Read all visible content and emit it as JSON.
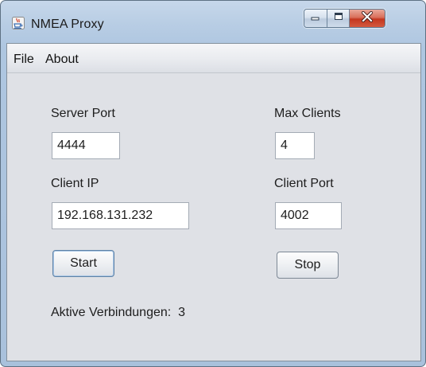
{
  "window": {
    "title": "NMEA Proxy",
    "icon": "java-cup-icon",
    "controls": [
      "minimize-icon",
      "maximize-icon",
      "close-icon"
    ]
  },
  "menu": {
    "items": [
      {
        "label": "File"
      },
      {
        "label": "About"
      }
    ]
  },
  "form": {
    "server_port": {
      "label": "Server Port",
      "value": "4444"
    },
    "max_clients": {
      "label": "Max Clients",
      "value": "4"
    },
    "client_ip": {
      "label": "Client IP",
      "value": "192.168.131.232"
    },
    "client_port": {
      "label": "Client Port",
      "value": "4002"
    },
    "start_label": "Start",
    "stop_label": "Stop",
    "status_text": "Aktive Verbindungen:  3"
  },
  "colors": {
    "close_button": "#c4371f",
    "frame": "#aec6e0",
    "panel": "#dfe1e6"
  }
}
